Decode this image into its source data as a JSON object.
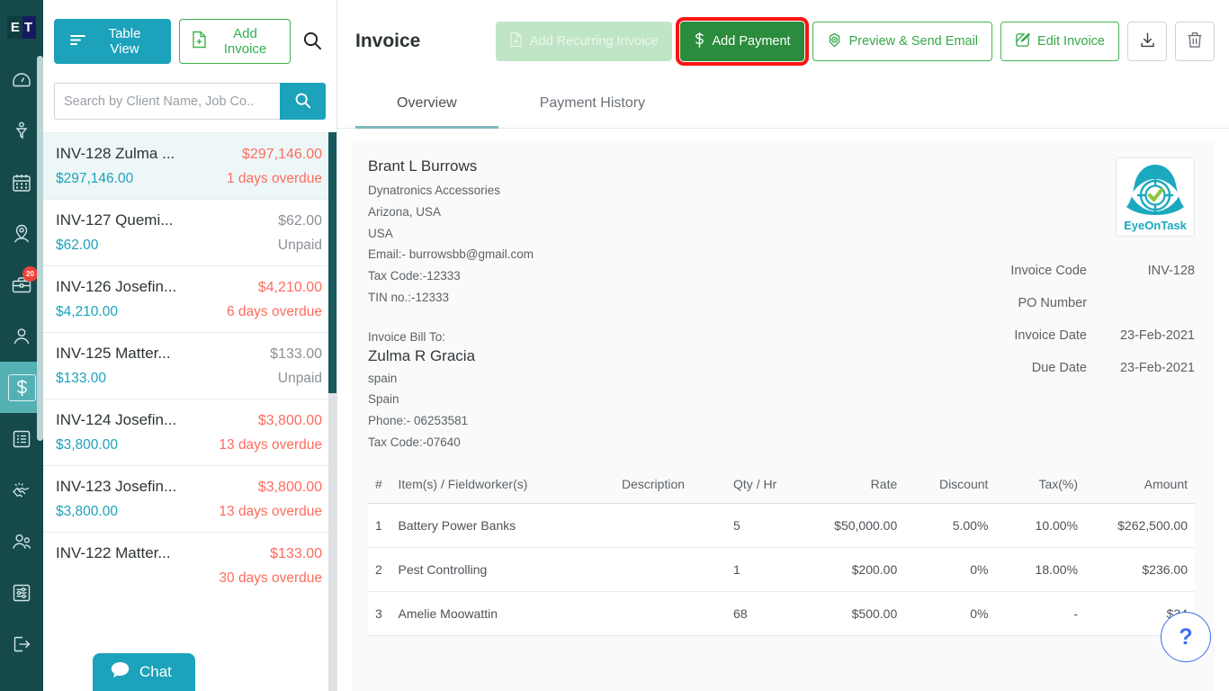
{
  "brand": {
    "logo_text_1": "E",
    "logo_text_2": "T",
    "teal": "#1ca2bb",
    "dark_teal": "#16494b",
    "green": "#2a8c3c",
    "highlight_red": "#fb1414",
    "overdue_red": "#ff6b5e"
  },
  "sidebar": {
    "items": [
      {
        "name": "dashboard",
        "icon": "gauge-icon",
        "badge": null,
        "active": false
      },
      {
        "name": "filter",
        "icon": "funnel-user-icon",
        "badge": null,
        "active": false
      },
      {
        "name": "calendar",
        "icon": "calendar-icon",
        "badge": null,
        "active": false
      },
      {
        "name": "locations",
        "icon": "map-pin-user-icon",
        "badge": null,
        "active": false
      },
      {
        "name": "jobs",
        "icon": "briefcase-icon",
        "badge": "20",
        "active": false
      },
      {
        "name": "clients",
        "icon": "user-icon",
        "badge": null,
        "active": false
      },
      {
        "name": "invoices",
        "icon": "dollar-icon",
        "badge": null,
        "active": true
      },
      {
        "name": "reports",
        "icon": "list-icon",
        "badge": null,
        "active": false
      },
      {
        "name": "partners",
        "icon": "handshake-icon",
        "badge": null,
        "active": false
      },
      {
        "name": "team",
        "icon": "users-icon",
        "badge": null,
        "active": false
      },
      {
        "name": "settings",
        "icon": "sliders-icon",
        "badge": null,
        "active": false
      },
      {
        "name": "logout",
        "icon": "logout-icon",
        "badge": null,
        "active": false
      }
    ]
  },
  "list_panel": {
    "table_view_label": "Table View",
    "add_invoice_label": "Add Invoice",
    "search_placeholder": "Search by Client Name, Job Co..",
    "search_value": "",
    "invoices": [
      {
        "title": "INV-128 Zulma ...",
        "amount": "$297,146.00",
        "due": "$297,146.00",
        "status": "1 days overdue",
        "overdue": true,
        "selected": true
      },
      {
        "title": "INV-127 Quemi...",
        "amount": "$62.00",
        "due": "$62.00",
        "status": "Unpaid",
        "overdue": false,
        "selected": false
      },
      {
        "title": "INV-126 Josefin...",
        "amount": "$4,210.00",
        "due": "$4,210.00",
        "status": "6 days overdue",
        "overdue": true,
        "selected": false
      },
      {
        "title": "INV-125 Matter...",
        "amount": "$133.00",
        "due": "$133.00",
        "status": "Unpaid",
        "overdue": false,
        "selected": false
      },
      {
        "title": "INV-124 Josefin...",
        "amount": "$3,800.00",
        "due": "$3,800.00",
        "status": "13 days overdue",
        "overdue": true,
        "selected": false
      },
      {
        "title": "INV-123 Josefin...",
        "amount": "$3,800.00",
        "due": "$3,800.00",
        "status": "13 days overdue",
        "overdue": true,
        "selected": false
      },
      {
        "title": "INV-122 Matter...",
        "amount": "$133.00",
        "due": "",
        "status": "30 days overdue",
        "overdue": true,
        "selected": false
      }
    ],
    "chat_label": "Chat"
  },
  "header": {
    "title": "Invoice",
    "buttons": {
      "add_recurring_invoice": "Add Recurring Invoice",
      "add_payment": "Add Payment",
      "preview_send_email": "Preview & Send Email",
      "edit_invoice": "Edit Invoice",
      "download": "",
      "delete": ""
    }
  },
  "tabs": [
    {
      "label": "Overview",
      "active": true
    },
    {
      "label": "Payment History",
      "active": false
    }
  ],
  "invoice": {
    "from": {
      "name": "Brant L Burrows",
      "company": "Dynatronics Accessories",
      "address1": "Arizona, USA",
      "country": "USA",
      "email": "Email:- burrowsbb@gmail.com",
      "tax_code": "Tax Code:-12333",
      "tin": "TIN no.:-12333"
    },
    "bill_to_label": "Invoice Bill To:",
    "to": {
      "name": "Zulma R Gracia",
      "address1": "spain",
      "country": "Spain",
      "phone": "Phone:- 06253581",
      "tax_code": "Tax Code:-07640"
    },
    "logo_alt": "EyeOnTask",
    "logo_caption": "EyeOnTask",
    "meta": [
      {
        "label": "Invoice Code",
        "value": "INV-128"
      },
      {
        "label": "PO Number",
        "value": ""
      },
      {
        "label": "Invoice Date",
        "value": "23-Feb-2021"
      },
      {
        "label": "Due Date",
        "value": "23-Feb-2021"
      }
    ],
    "table": {
      "headers": [
        "#",
        "Item(s) / Fieldworker(s)",
        "Description",
        "Qty / Hr",
        "Rate",
        "Discount",
        "Tax(%)",
        "Amount"
      ],
      "rows": [
        {
          "num": "1",
          "item": "Battery Power Banks",
          "description": "",
          "qty": "5",
          "rate": "$50,000.00",
          "discount": "5.00%",
          "tax": "10.00%",
          "amount": "$262,500.00"
        },
        {
          "num": "2",
          "item": "Pest Controlling",
          "description": "",
          "qty": "1",
          "rate": "$200.00",
          "discount": "0%",
          "tax": "18.00%",
          "amount": "$236.00"
        },
        {
          "num": "3",
          "item": "Amelie Moowattin",
          "description": "",
          "qty": "68",
          "rate": "$500.00",
          "discount": "0%",
          "tax": "-",
          "amount": "$34"
        }
      ]
    }
  },
  "help_fab": {
    "label": "?"
  }
}
